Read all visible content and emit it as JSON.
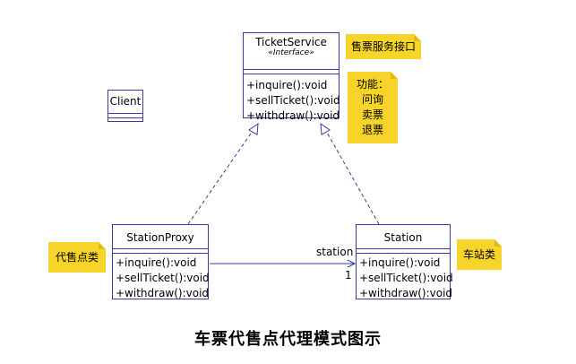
{
  "ticket_service": {
    "name": "TicketService",
    "stereotype": "«Interface»",
    "operations": [
      "+inquire():void",
      "+sellTicket():void",
      "+withdraw():void"
    ]
  },
  "client": {
    "name": "Client"
  },
  "station_proxy": {
    "name": "StationProxy",
    "operations": [
      "+inquire():void",
      "+sellTicket():void",
      "+withdraw():void"
    ]
  },
  "station": {
    "name": "Station",
    "operations": [
      "+inquire():void",
      "+sellTicket():void",
      "+withdraw():void"
    ]
  },
  "notes": {
    "interface_note": "售票服务接口",
    "function_note": [
      "功能：",
      "问询",
      "卖票",
      "退票"
    ],
    "proxy_note": "代售点类",
    "station_note": "车站类"
  },
  "association": {
    "role": "station",
    "multiplicity": "1"
  },
  "caption": "车票代售点代理模式图示"
}
